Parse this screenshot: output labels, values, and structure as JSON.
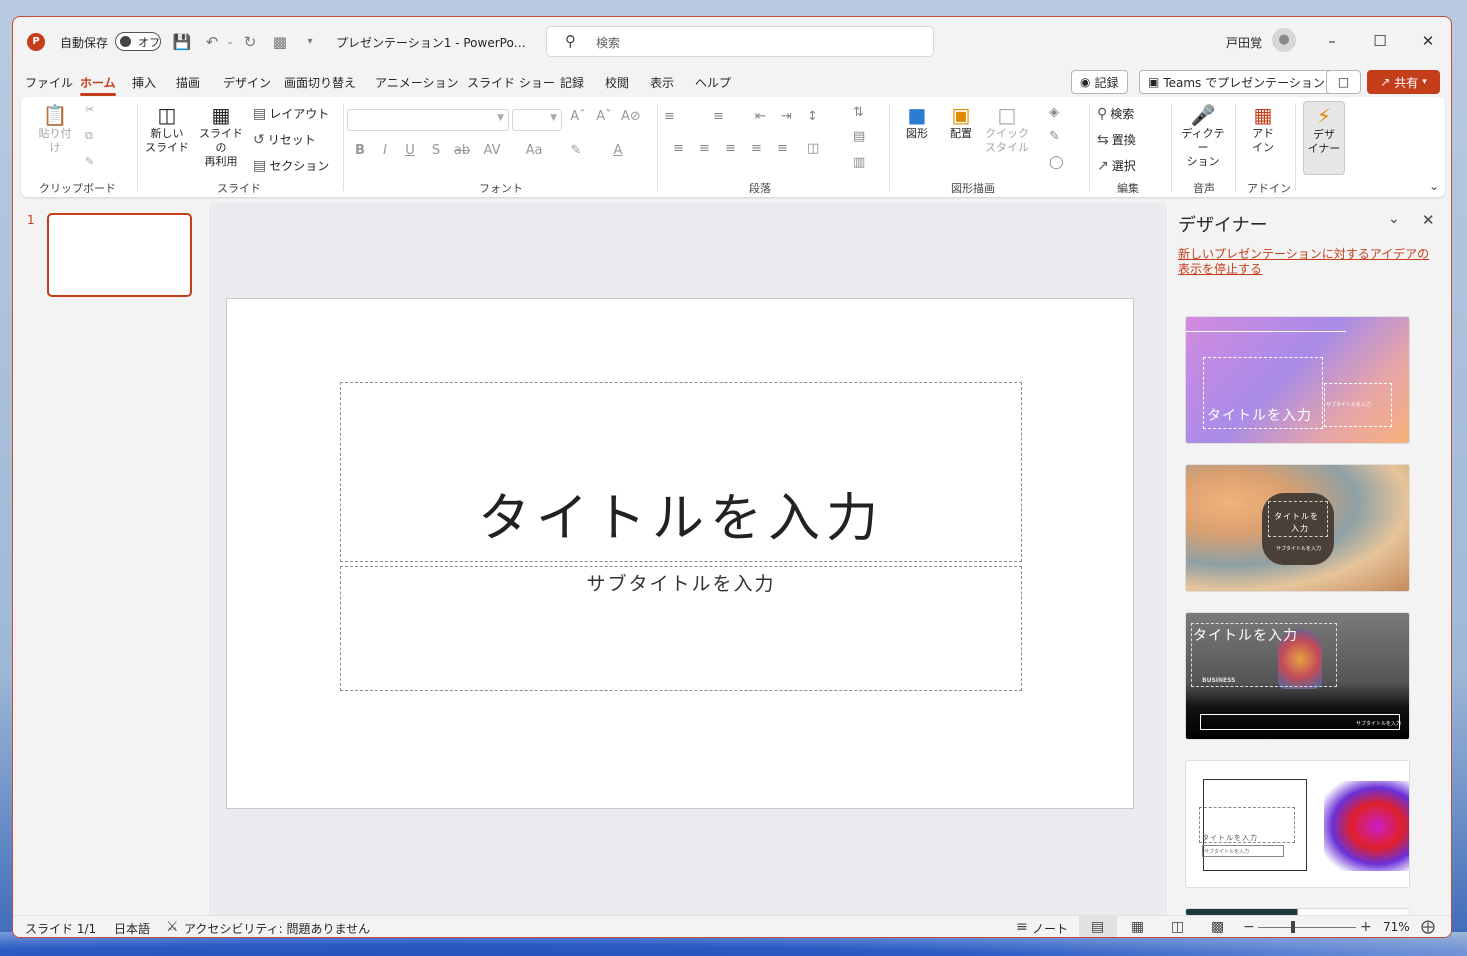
{
  "titlebar": {
    "autosave_label": "自動保存",
    "autosave_state": "オフ",
    "doc_title": "プレゼンテーション1  -  PowerPo…",
    "search_placeholder": "検索",
    "user_name": "戸田覚"
  },
  "tabs": [
    "ファイル",
    "ホーム",
    "挿入",
    "描画",
    "デザイン",
    "画面切り替え",
    "アニメーション",
    "スライド ショー",
    "記録",
    "校閲",
    "表示",
    "ヘルプ"
  ],
  "active_tab": "ホーム",
  "header_actions": {
    "record": "記録",
    "teams": "Teams でプレゼンテーション",
    "share": "共有"
  },
  "ribbon": {
    "clipboard": {
      "paste": "貼り付け",
      "group": "クリップボード"
    },
    "slides": {
      "new_slide_1": "新しい",
      "new_slide_2": "スライド",
      "reuse_1": "スライドの",
      "reuse_2": "再利用",
      "layout": "レイアウト",
      "reset": "リセット",
      "section": "セクション",
      "group": "スライド"
    },
    "font": {
      "group": "フォント"
    },
    "paragraph": {
      "group": "段落"
    },
    "drawing": {
      "shapes": "図形",
      "arrange": "配置",
      "quick_style_1": "クイック",
      "quick_style_2": "スタイル",
      "group": "図形描画"
    },
    "editing": {
      "find": "検索",
      "replace": "置換",
      "select": "選択",
      "group": "編集"
    },
    "voice": {
      "dictate_1": "ディクテー",
      "dictate_2": "ション",
      "group": "音声"
    },
    "addins": {
      "addin_1": "アド",
      "addin_2": "イン",
      "group": "アドイン"
    },
    "designer": {
      "label_1": "デザ",
      "label_2": "イナー"
    }
  },
  "slide_pane": {
    "slide_number": "1"
  },
  "slide": {
    "title_placeholder": "タイトルを入力",
    "subtitle_placeholder": "サブタイトルを入力"
  },
  "designer_pane": {
    "title": "デザイナー",
    "stop_link": "新しいプレゼンテーションに対するアイデアの表示を停止する",
    "idea_title": "タイトルを入力",
    "idea_title_split_1": "タイトルを",
    "idea_title_split_2": "入力",
    "idea_subtitle": "サブタイトルを入力",
    "idea_business": "BUSINESS"
  },
  "statusbar": {
    "slide_count": "スライド 1/1",
    "language": "日本語",
    "accessibility": "アクセシビリティ: 問題ありません",
    "notes": "ノート",
    "zoom": "71%"
  },
  "colors": {
    "accent": "#c43e1c",
    "ribbon_bg": "#ffffff",
    "window_bg": "#f3f3f3"
  }
}
